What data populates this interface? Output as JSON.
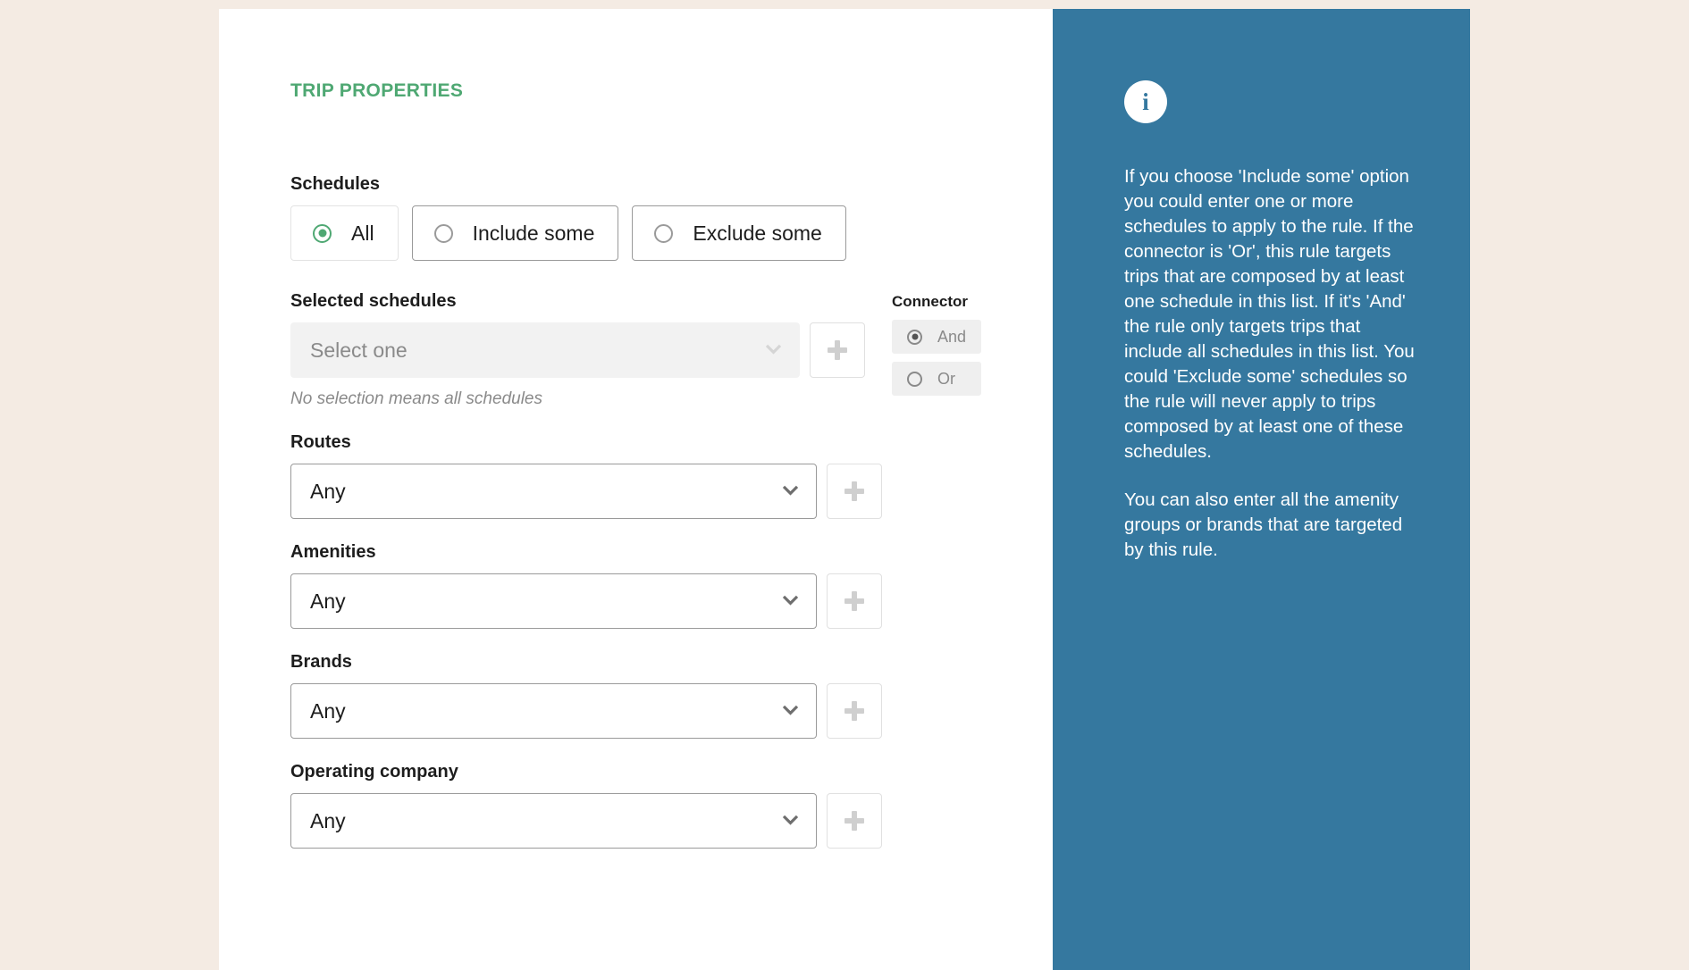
{
  "section": {
    "title": "TRIP PROPERTIES",
    "accent_color": "#4fa873"
  },
  "schedules": {
    "label": "Schedules",
    "options": [
      {
        "label": "All",
        "selected": true
      },
      {
        "label": "Include some",
        "selected": false
      },
      {
        "label": "Exclude some",
        "selected": false
      }
    ]
  },
  "selected_schedules": {
    "label": "Selected schedules",
    "value": "Select one",
    "placeholder": "Select one",
    "hint": "No selection means all schedules",
    "add_icon": "plus-icon",
    "chevron_icon": "chevron-down-icon",
    "disabled": true
  },
  "connector": {
    "label": "Connector",
    "options": [
      {
        "label": "And",
        "selected": true
      },
      {
        "label": "Or",
        "selected": false
      }
    ]
  },
  "fields": [
    {
      "label": "Routes",
      "value": "Any"
    },
    {
      "label": "Amenities",
      "value": "Any"
    },
    {
      "label": "Brands",
      "value": "Any"
    },
    {
      "label": "Operating company",
      "value": "Any"
    }
  ],
  "info_panel": {
    "background_color": "#35789f",
    "icon": "info-icon",
    "icon_glyph": "i",
    "paragraphs": [
      "If you choose 'Include some' option you could enter one or more schedules to apply to the rule. If the connector is 'Or', this rule targets trips that are composed by at least one schedule in this list. If it's 'And' the rule only targets trips that include all schedules in this list. You could 'Exclude some' schedules so the rule will never apply to trips composed by at least one of these schedules.",
      "You can also enter all the amenity groups or brands that are targeted by this rule."
    ]
  }
}
